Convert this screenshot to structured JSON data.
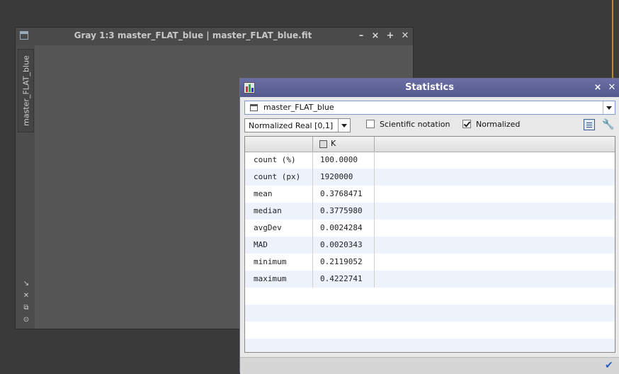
{
  "image_window": {
    "title": "Gray 1:3 master_FLAT_blue | master_FLAT_blue.fit",
    "tab_label": "master_FLAT_blue",
    "buttons": [
      "–",
      "⨯",
      "✚",
      "✕"
    ]
  },
  "statistics": {
    "title": "Statistics",
    "view": "master_FLAT_blue",
    "format": "Normalized Real [0,1]",
    "scientific_notation": {
      "label": "Scientific notation",
      "checked": false
    },
    "normalized": {
      "label": "Normalized",
      "checked": true
    },
    "channel_header": "K",
    "rows": [
      {
        "name": "count (%)",
        "value": "100.0000"
      },
      {
        "name": "count (px)",
        "value": "1920000"
      },
      {
        "name": "mean",
        "value": "0.3768471"
      },
      {
        "name": "median",
        "value": "0.3775980"
      },
      {
        "name": "avgDev",
        "value": "0.0024284"
      },
      {
        "name": "MAD",
        "value": "0.0020343"
      },
      {
        "name": "minimum",
        "value": "0.2119052"
      },
      {
        "name": "maximum",
        "value": "0.4222741"
      }
    ]
  },
  "colors": {
    "title_bar": "#5a5f96",
    "row_alt": "#eef3fb",
    "desktop": "#3a3a3a"
  }
}
